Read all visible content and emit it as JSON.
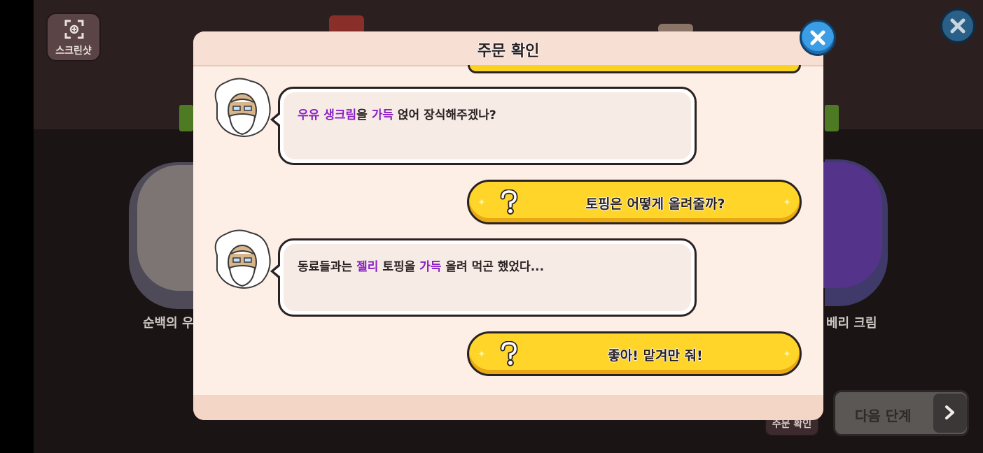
{
  "screenshot_button": {
    "label": "스크린샷",
    "icon": "screenshot-frame-icon"
  },
  "background": {
    "left_cream_label": "순백의 우",
    "right_cream_label": "베리 크림"
  },
  "next_button": {
    "label": "다음 단계",
    "icon": "chevron-right-icon"
  },
  "order_check_tab": {
    "label": "주문 확인"
  },
  "modal": {
    "title": "주문 확인",
    "dialogs": [
      {
        "speaker": "old-cookie-avatar",
        "segments": [
          {
            "text": "우유 생크림",
            "highlight": true
          },
          {
            "text": "을 ",
            "highlight": false
          },
          {
            "text": "가득",
            "highlight": true
          },
          {
            "text": " 얹어 장식해주겠나?",
            "highlight": false
          }
        ]
      },
      {
        "speaker": "old-cookie-avatar",
        "segments": [
          {
            "text": "동료들과는 ",
            "highlight": false
          },
          {
            "text": "젤리",
            "highlight": true
          },
          {
            "text": " 토핑을 ",
            "highlight": false
          },
          {
            "text": "가득",
            "highlight": true
          },
          {
            "text": " 올려 먹곤 했었다...",
            "highlight": false
          }
        ]
      }
    ],
    "choices": [
      {
        "label": "토핑은 어떻게 올려줄까?",
        "icon": "question-mark-icon"
      },
      {
        "label": "좋아! 맡겨만 줘!",
        "icon": "question-mark-icon"
      }
    ]
  },
  "colors": {
    "highlight": "#8a1fc5",
    "choice_yellow": "#ffd52a",
    "close_blue": "#3a9de6"
  }
}
